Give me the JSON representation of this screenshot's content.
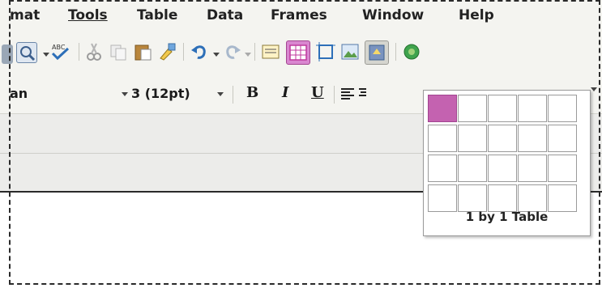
{
  "menubar": {
    "items": [
      {
        "label": "mat",
        "key": "format"
      },
      {
        "label": "Tools"
      },
      {
        "label": "Table"
      },
      {
        "label": "Data"
      },
      {
        "label": "Frames"
      },
      {
        "label": "Window"
      },
      {
        "label": "Help"
      }
    ]
  },
  "format_bar": {
    "font_name": "an",
    "font_size": "3 (12pt)",
    "bold_label": "B",
    "italic_label": "I",
    "underline_label": "U"
  },
  "table_picker": {
    "rows": 4,
    "cols": 5,
    "selected_rows": 1,
    "selected_cols": 1,
    "label": "1 by 1 Table",
    "highlight_color": "#c462b0"
  },
  "colors": {
    "toolbar_bg": "#f4f4f0",
    "band_bg": "#ececea",
    "active_button": "#d987d0"
  }
}
